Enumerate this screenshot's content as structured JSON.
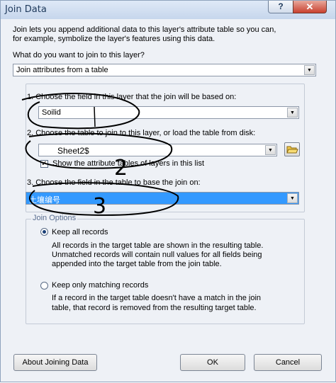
{
  "window": {
    "title": "Join Data",
    "help_glyph": "?",
    "close_glyph": "✕"
  },
  "intro": {
    "line1": "Join lets you append additional data to this layer's attribute table so you can,",
    "line2": "for example, symbolize the layer's features using this data."
  },
  "question": "What do you want to join to this layer?",
  "join_type": {
    "value": "Join attributes from a table"
  },
  "step1": {
    "label": "1.  Choose the field in this layer that the join will be based on:",
    "value": "Soilid"
  },
  "step2": {
    "label": "2.  Choose the table to join to this layer, or load the table from disk:",
    "value": "Sheet2$",
    "checkbox_label": "Show the attribute tables of layers in this list",
    "checked": true
  },
  "step3": {
    "label": "3.  Choose the field in the table to base the join on:",
    "value": "土壤编号"
  },
  "join_options": {
    "title": "Join Options",
    "keep_all": {
      "label": "Keep all records",
      "desc1": "All records in the target table are shown in the resulting table.",
      "desc2": "Unmatched records will contain null values for all fields being",
      "desc3": "appended into the target table from the join table.",
      "selected": true
    },
    "keep_matching": {
      "label": "Keep only matching records",
      "desc1": "If a record in the target table doesn't have a match in the join",
      "desc2": "table, that record is removed from the resulting target table.",
      "selected": false
    }
  },
  "buttons": {
    "about": "About Joining Data",
    "ok": "OK",
    "cancel": "Cancel"
  },
  "annotations": {
    "n2": "2",
    "n3": "3"
  }
}
